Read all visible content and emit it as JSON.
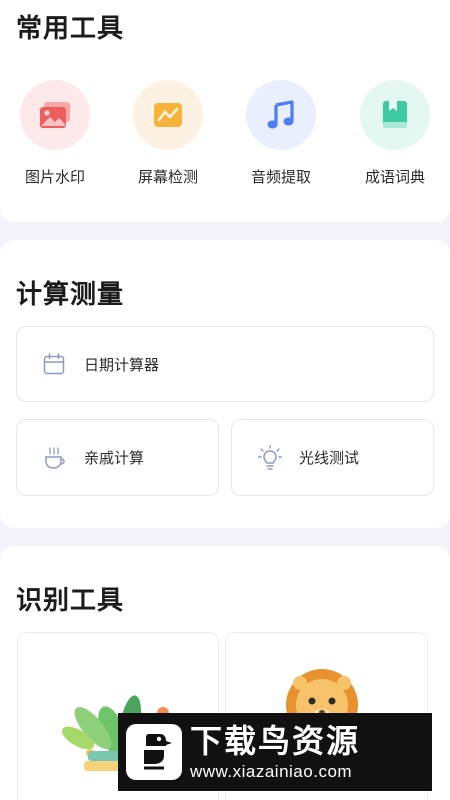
{
  "sections": {
    "common": {
      "title": "常用工具",
      "tools": [
        {
          "label": "图片水印",
          "icon": "image-watermark-icon",
          "bg": "#fde9e9",
          "color": "#ee5d5d"
        },
        {
          "label": "屏幕检测",
          "icon": "screen-test-icon",
          "bg": "#fdf1e4",
          "color": "#f6a934"
        },
        {
          "label": "音频提取",
          "icon": "music-note-icon",
          "bg": "#e9effd",
          "color": "#4f7cf3"
        },
        {
          "label": "成语词典",
          "icon": "book-icon",
          "bg": "#e5f7f1",
          "color": "#3ec9a0"
        }
      ]
    },
    "calc": {
      "title": "计算测量",
      "date_calc": "日期计算器",
      "relative_calc": "亲戚计算",
      "light_test": "光线测试"
    },
    "recognition": {
      "title": "识别工具",
      "cards": [
        {
          "name": "plant-illustration"
        },
        {
          "name": "animal-illustration"
        }
      ]
    }
  },
  "watermark": {
    "title": "下载鸟资源",
    "url": "www.xiazainiao.com"
  },
  "colors": {
    "icon_outline": "#8a9ac7",
    "background": "#f4f3fb"
  }
}
